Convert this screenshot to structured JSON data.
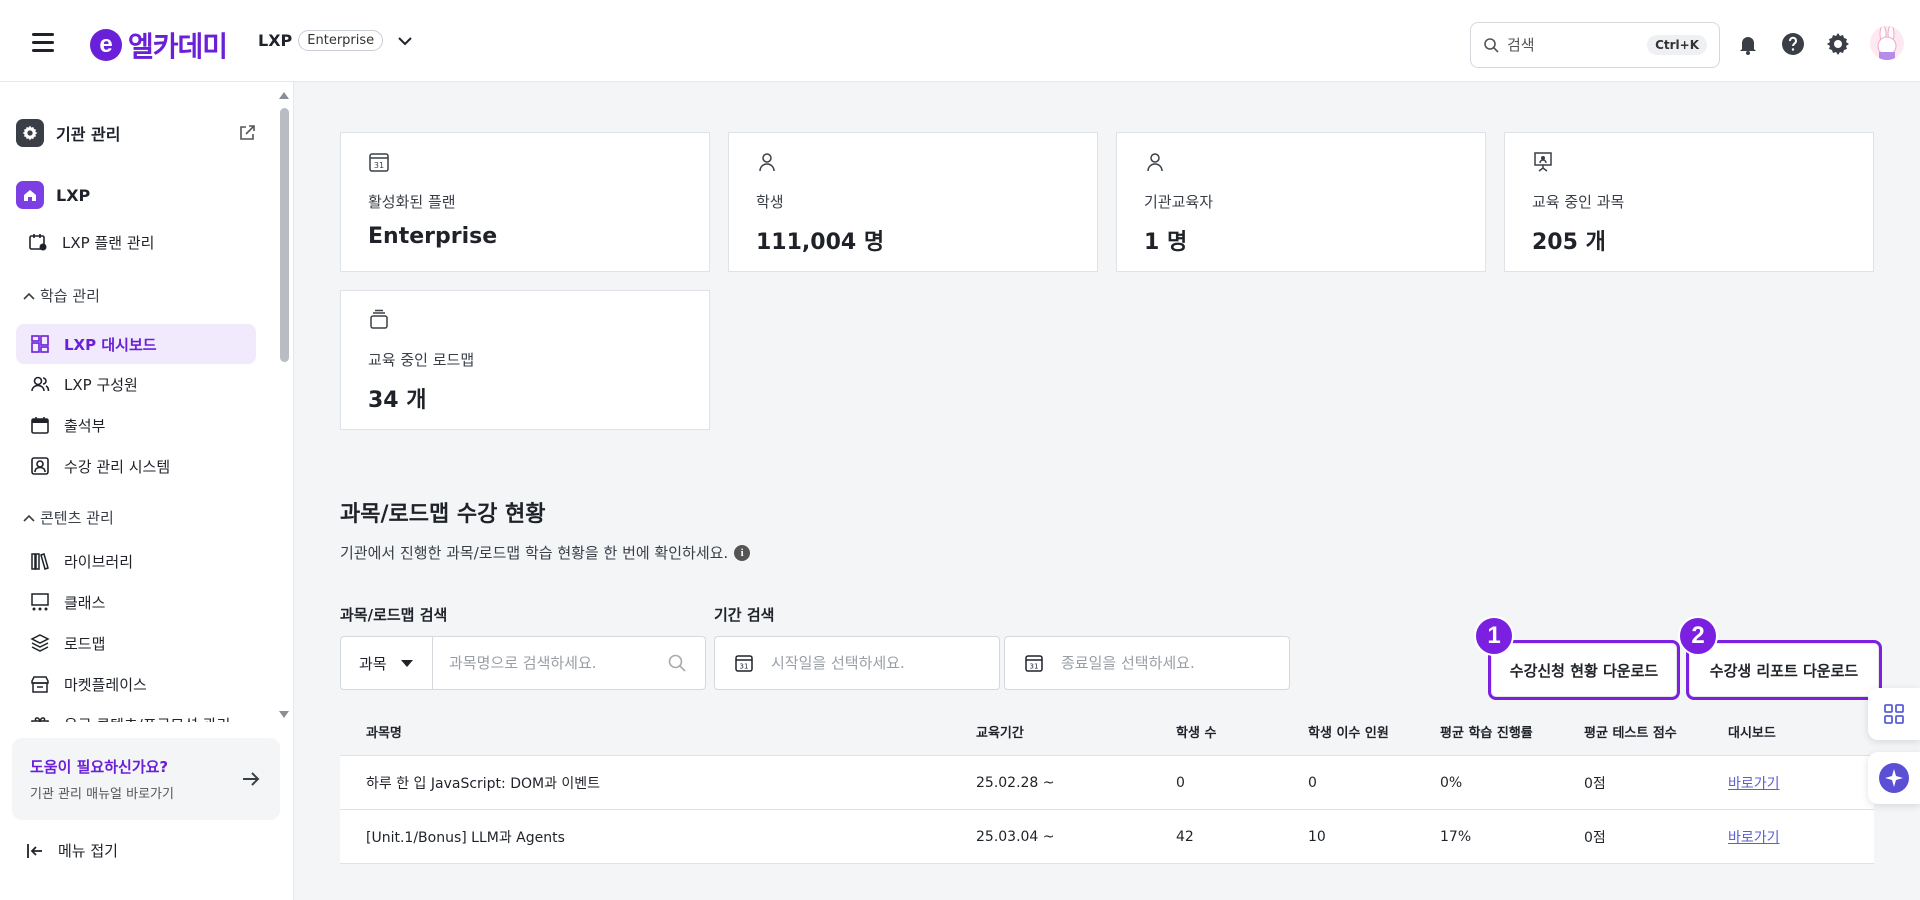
{
  "header": {
    "logo_mark": "e",
    "logo_text": "엘카데미",
    "plan_name": "LXP",
    "plan_badge": "Enterprise",
    "search_placeholder": "검색",
    "search_shortcut": "Ctrl+K"
  },
  "sidebar": {
    "org_admin": "기관 관리",
    "lxp": "LXP",
    "lxp_plan": "LXP 플랜 관리",
    "group_learning": "학습 관리",
    "learning_items": [
      "LXP 대시보드",
      "LXP 구성원",
      "출석부",
      "수강 관리 시스템"
    ],
    "group_contents": "콘텐츠 관리",
    "content_items": [
      "라이브러리",
      "클래스",
      "로드맵",
      "마켓플레이스",
      "유료 콘텐츠/프로모션 관리"
    ],
    "help_title": "도움이 필요하신가요?",
    "help_sub": "기관 관리 매뉴얼 바로가기",
    "collapse": "메뉴 접기"
  },
  "stats": [
    {
      "label": "활성화된 플랜",
      "value": "Enterprise",
      "icon": "calendar-icon"
    },
    {
      "label": "학생",
      "value": "111,004 명",
      "icon": "person-icon"
    },
    {
      "label": "기관교육자",
      "value": "1 명",
      "icon": "person-icon"
    },
    {
      "label": "교육 중인 과목",
      "value": "205 개",
      "icon": "presentation-icon"
    },
    {
      "label": "교육 중인 로드맵",
      "value": "34 개",
      "icon": "stack-icon"
    }
  ],
  "section": {
    "title": "과목/로드맵 수강 현황",
    "desc": "기관에서 진행한 과목/로드맵 학습 현황을 한 번에 확인하세요.",
    "info": "i"
  },
  "filters": {
    "course_label": "과목/로드맵 검색",
    "type_value": "과목",
    "course_placeholder": "과목명으로 검색하세요.",
    "period_label": "기간 검색",
    "start_placeholder": "시작일을 선택하세요.",
    "end_placeholder": "종료일을 선택하세요."
  },
  "buttons": {
    "download_enroll": "수강신청 현황 다운로드",
    "download_report": "수강생 리포트 다운로드",
    "badge1": "1",
    "badge2": "2"
  },
  "table": {
    "columns": [
      "과목명",
      "교육기간",
      "학생 수",
      "학생 이수 인원",
      "평균 학습 진행률",
      "평균 테스트 점수",
      "대시보드"
    ],
    "rows": [
      [
        "하루 한 입 JavaScript: DOM과 이벤트",
        "25.02.28 ~",
        "0",
        "0",
        "0%",
        "0점",
        "바로가기"
      ],
      [
        "[Unit.1/Bonus] LLM과 Agents",
        "25.03.04 ~",
        "42",
        "10",
        "17%",
        "0점",
        "바로가기"
      ]
    ]
  },
  "colors": {
    "brand": "#6a1fd9",
    "highlight": "#7b20e0"
  }
}
